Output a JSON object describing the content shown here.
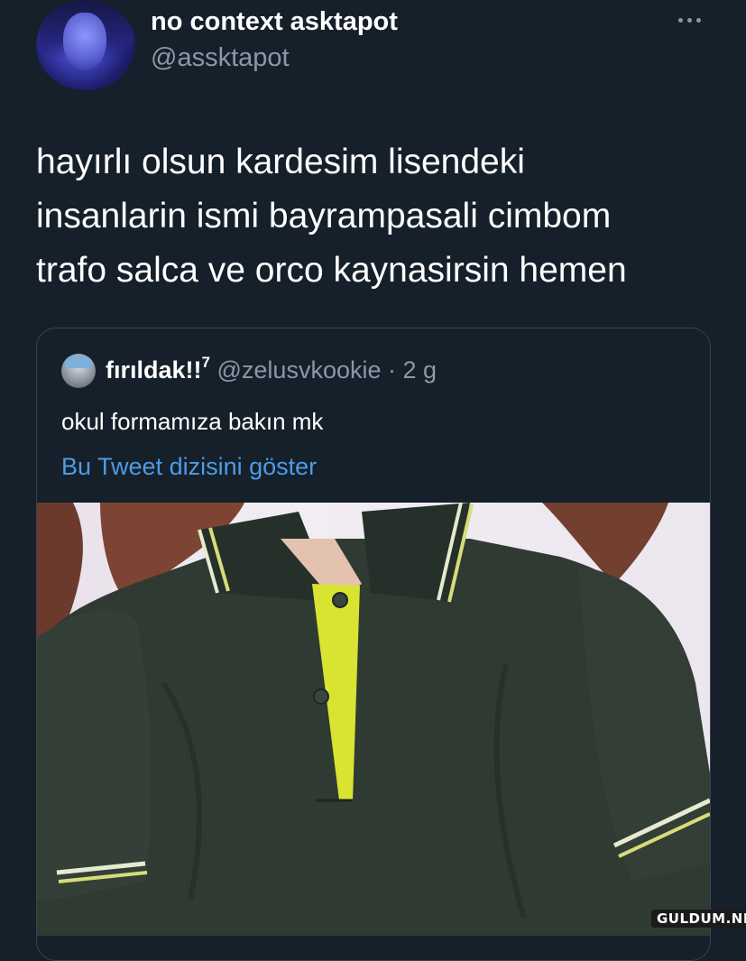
{
  "tweet": {
    "author_name": "no context asktapot",
    "author_handle": "@assktapot",
    "text_lines": [
      "hayırlı olsun kardesim lisendeki",
      "insanlarin ismi bayrampasali cimbom",
      "trafo salca ve orco kaynasirsin hemen"
    ],
    "more_icon": "more-horizontal-icon"
  },
  "quote": {
    "author_name": "fırıldak!!",
    "author_name_sup": "7",
    "author_handle": "@zelusvkookie",
    "separator": "·",
    "timestamp": "2 g",
    "text": "okul formamıza bakın mk",
    "show_thread_link": "Bu Tweet dizisini göster",
    "media_description": "photo",
    "colors": {
      "shirt": "#2f3a33",
      "placket": "#d9e332",
      "collar_stripe": "#dbe08a"
    }
  },
  "watermark": "GULDUM.NET",
  "colors": {
    "background": "#15202b",
    "link": "#4d9be6",
    "secondary_text": "#8b98a5",
    "border": "#38444d"
  }
}
